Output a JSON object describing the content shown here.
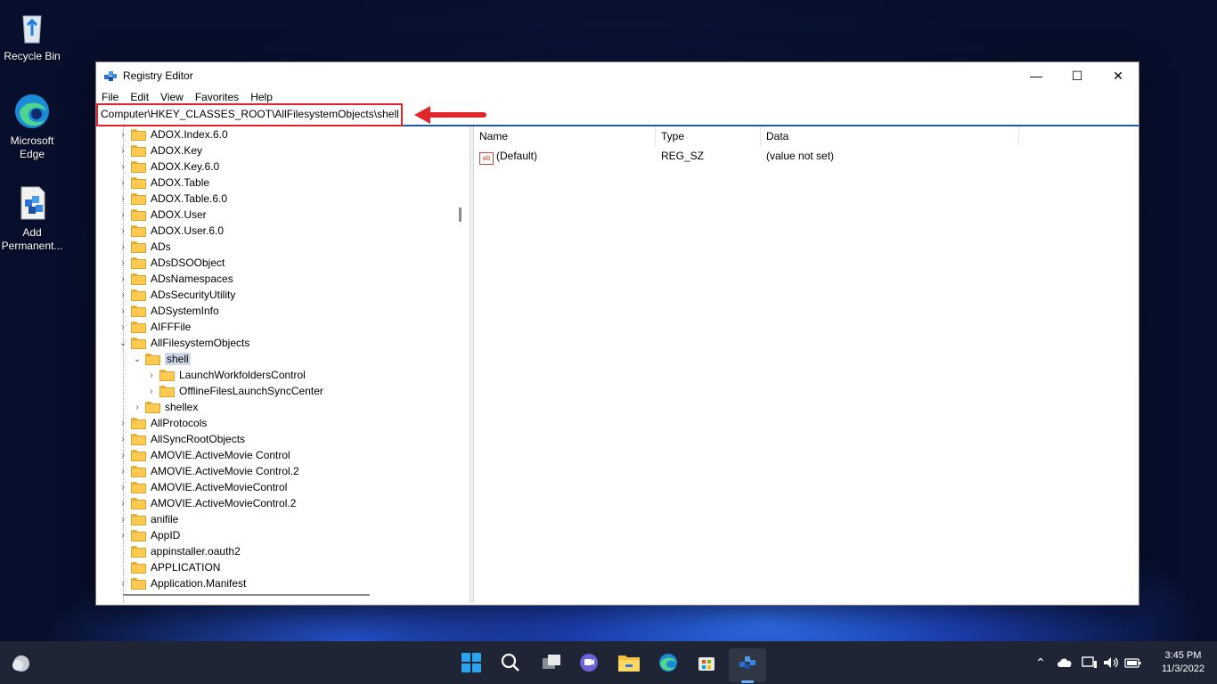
{
  "desktop": {
    "icons": [
      {
        "label": "Recycle Bin"
      },
      {
        "label": "Microsoft Edge"
      },
      {
        "label": "Add Permanent..."
      }
    ]
  },
  "window": {
    "title": "Registry Editor",
    "controls": {
      "minimize": "—",
      "maximize": "☐",
      "close": "✕"
    },
    "menu": [
      "File",
      "Edit",
      "View",
      "Favorites",
      "Help"
    ],
    "address": "Computer\\HKEY_CLASSES_ROOT\\AllFilesystemObjects\\shell",
    "tree": [
      {
        "label": "ADOX.Index.6.0",
        "chev": "›",
        "level": 0
      },
      {
        "label": "ADOX.Key",
        "chev": "›",
        "level": 0
      },
      {
        "label": "ADOX.Key.6.0",
        "chev": "›",
        "level": 0
      },
      {
        "label": "ADOX.Table",
        "chev": "›",
        "level": 0
      },
      {
        "label": "ADOX.Table.6.0",
        "chev": "›",
        "level": 0
      },
      {
        "label": "ADOX.User",
        "chev": "›",
        "level": 0
      },
      {
        "label": "ADOX.User.6.0",
        "chev": "›",
        "level": 0
      },
      {
        "label": "ADs",
        "chev": "›",
        "level": 0
      },
      {
        "label": "ADsDSOObject",
        "chev": "›",
        "level": 0
      },
      {
        "label": "ADsNamespaces",
        "chev": "›",
        "level": 0
      },
      {
        "label": "ADsSecurityUtility",
        "chev": "›",
        "level": 0
      },
      {
        "label": "ADSystemInfo",
        "chev": "›",
        "level": 0
      },
      {
        "label": "AIFFFile",
        "chev": "›",
        "level": 0
      },
      {
        "label": "AllFilesystemObjects",
        "chev": "⌄",
        "level": 0
      },
      {
        "label": "shell",
        "chev": "⌄",
        "level": 1,
        "selected": true
      },
      {
        "label": "LaunchWorkfoldersControl",
        "chev": "›",
        "level": 2
      },
      {
        "label": "OfflineFilesLaunchSyncCenter",
        "chev": "›",
        "level": 2
      },
      {
        "label": "shellex",
        "chev": "›",
        "level": 1
      },
      {
        "label": "AllProtocols",
        "chev": "›",
        "level": 0
      },
      {
        "label": "AllSyncRootObjects",
        "chev": "›",
        "level": 0
      },
      {
        "label": "AMOVIE.ActiveMovie Control",
        "chev": "›",
        "level": 0
      },
      {
        "label": "AMOVIE.ActiveMovie Control.2",
        "chev": "›",
        "level": 0
      },
      {
        "label": "AMOVIE.ActiveMovieControl",
        "chev": "›",
        "level": 0
      },
      {
        "label": "AMOVIE.ActiveMovieControl.2",
        "chev": "›",
        "level": 0
      },
      {
        "label": "anifile",
        "chev": "›",
        "level": 0
      },
      {
        "label": "AppID",
        "chev": "›",
        "level": 0
      },
      {
        "label": "appinstaller.oauth2",
        "chev": "",
        "level": 0
      },
      {
        "label": "APPLICATION",
        "chev": "",
        "level": 0
      },
      {
        "label": "Application.Manifest",
        "chev": "›",
        "level": 0
      }
    ],
    "values_pane": {
      "columns": [
        "Name",
        "Type",
        "Data"
      ],
      "rows": [
        {
          "icon": "ab",
          "name": "(Default)",
          "type": "REG_SZ",
          "data": "(value not set)"
        }
      ]
    }
  },
  "taskbar": {
    "clock_time": "3:45 PM",
    "clock_date": "11/3/2022",
    "tray_chevron": "⌃"
  },
  "colors": {
    "highlight_border": "#e0252b",
    "address_underline": "#1c5aa6",
    "selection": "#ccd8e8",
    "taskbar": "#1f2535"
  }
}
